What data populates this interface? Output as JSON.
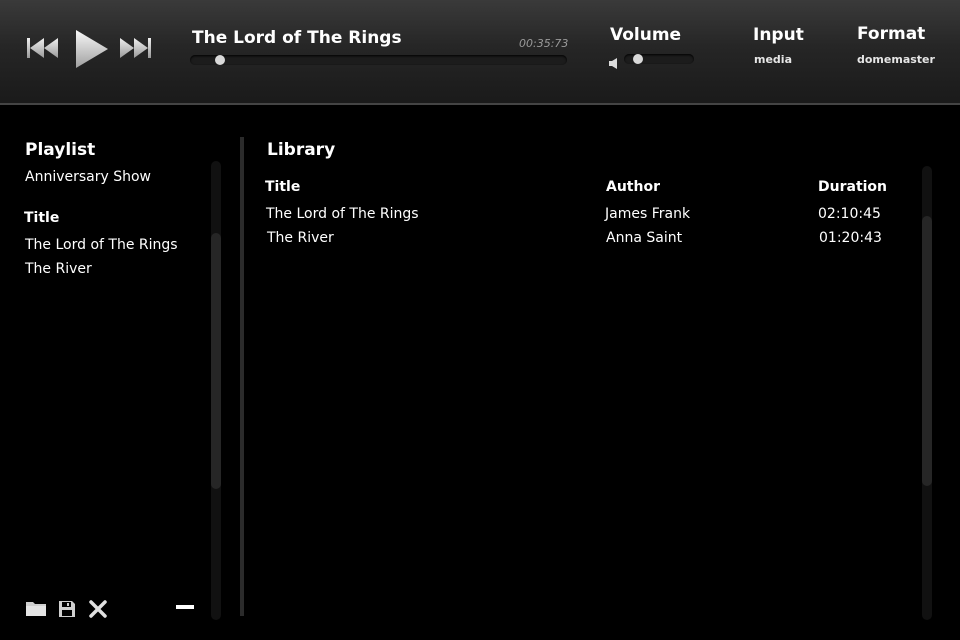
{
  "player": {
    "now_playing": "The Lord of The Rings",
    "elapsed": "00:35:73",
    "seek_fraction": 0.08,
    "controls": {
      "previous_icon": "skip-back-icon",
      "play_icon": "play-icon",
      "next_icon": "skip-forward-icon"
    }
  },
  "volume": {
    "label": "Volume",
    "level_fraction": 0.2,
    "icon": "speaker-icon"
  },
  "input": {
    "label": "Input",
    "value": "media"
  },
  "format": {
    "label": "Format",
    "value": "domemaster"
  },
  "playlist": {
    "heading": "Playlist",
    "name": "Anniversary Show",
    "column_title": "Title",
    "items": [
      "The Lord of The Rings",
      "The River"
    ],
    "footer_icons": [
      "folder-icon",
      "save-icon",
      "close-icon",
      "minus-icon"
    ]
  },
  "library": {
    "heading": "Library",
    "columns": {
      "title": "Title",
      "author": "Author",
      "duration": "Duration"
    },
    "rows": [
      {
        "title": "The Lord of The Rings",
        "author": "James Frank",
        "duration": "02:10:45"
      },
      {
        "title": "The River",
        "author": "Anna Saint",
        "duration": "01:20:43"
      }
    ]
  },
  "colors": {
    "background": "#000000",
    "header_top": "#3a3a3a",
    "header_bottom": "#1a1a1a",
    "text": "#ffffff",
    "muted_text": "#9a9a9a",
    "knob": "#d9d9d9"
  }
}
